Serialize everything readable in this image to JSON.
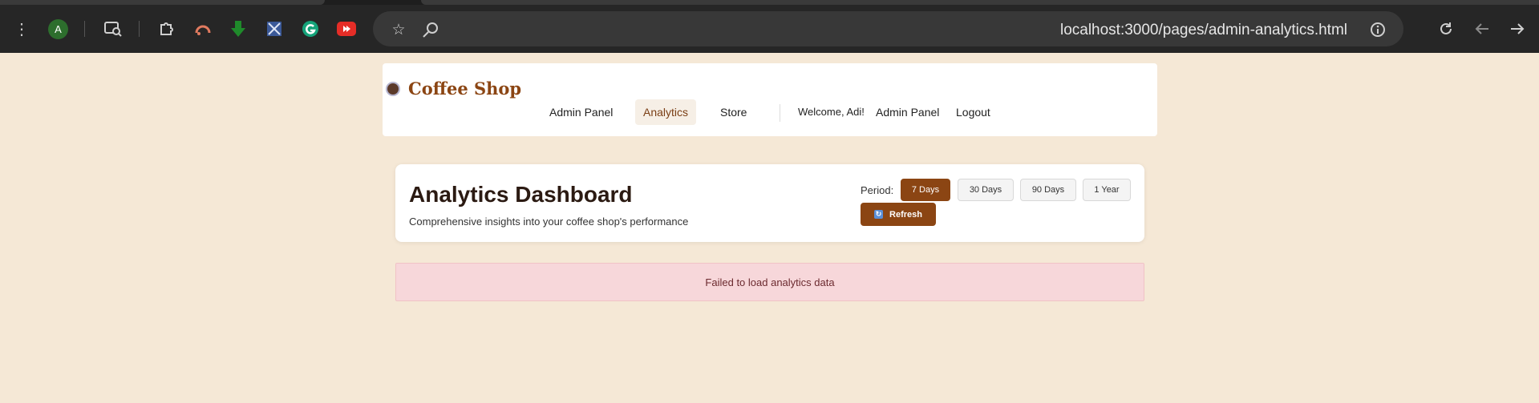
{
  "browser": {
    "profile_initial": "A",
    "url": "localhost:3000/pages/admin-analytics.html",
    "icons": [
      "menu-dots-icon",
      "tab-search-icon",
      "extensions-icon",
      "speed-icon",
      "green-arrow-icon",
      "blue-extension-icon",
      "grammarly-icon",
      "youtube-icon",
      "star-icon",
      "zoom-icon",
      "info-icon",
      "reload-icon",
      "back-icon",
      "forward-icon"
    ]
  },
  "header": {
    "brand": "Coffee Shop",
    "nav": [
      "Admin Panel",
      "Analytics",
      "Store"
    ],
    "welcome": "Welcome, Adi!",
    "admin_link": "Admin Panel",
    "logout": "Logout"
  },
  "dashboard": {
    "title": "Analytics Dashboard",
    "subtitle": "Comprehensive insights into your coffee shop's performance",
    "period_label": "Period:",
    "periods": [
      "7 Days",
      "30 Days",
      "90 Days",
      "1 Year"
    ],
    "selected_period": "7 Days",
    "refresh_label": "Refresh"
  },
  "error": {
    "message": "Failed to load analytics data"
  },
  "colors": {
    "accent": "#8b4513",
    "page_bg": "#f5e8d6",
    "error_bg": "#f7d7da"
  }
}
